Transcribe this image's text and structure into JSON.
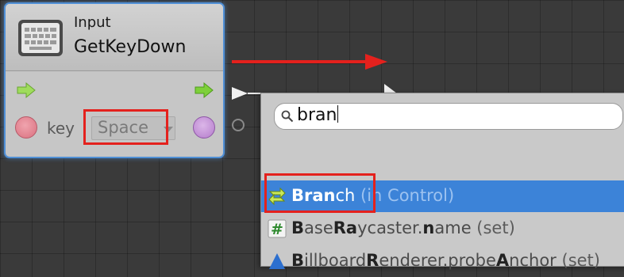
{
  "node": {
    "kind": "Input",
    "title": "GetKeyDown",
    "key_label": "key",
    "key_value": "Space"
  },
  "finder": {
    "search_value": "bran",
    "results": [
      {
        "name_bold": "Bran",
        "name_rest": "ch",
        "context": " (in Control)",
        "icon": "branch-icon",
        "selected": true
      },
      {
        "name_parts": [
          [
            "B",
            true
          ],
          [
            "ase",
            false
          ],
          [
            "Ra",
            true
          ],
          [
            "ycaster.",
            false
          ],
          [
            "n",
            true
          ],
          [
            "ame",
            false
          ]
        ],
        "context": " (set)",
        "icon": "hash-icon",
        "selected": false
      },
      {
        "name_parts": [
          [
            "B",
            true
          ],
          [
            "illboard",
            false
          ],
          [
            "R",
            true
          ],
          [
            "enderer.probe",
            false
          ],
          [
            "A",
            true
          ],
          [
            "nchor",
            false
          ]
        ],
        "context": " (set)",
        "icon": "triangle-icon",
        "selected": false
      }
    ]
  },
  "colors": {
    "highlight": "#e4211d",
    "selection": "#3c83d8",
    "node_border": "#4f8fd6"
  }
}
